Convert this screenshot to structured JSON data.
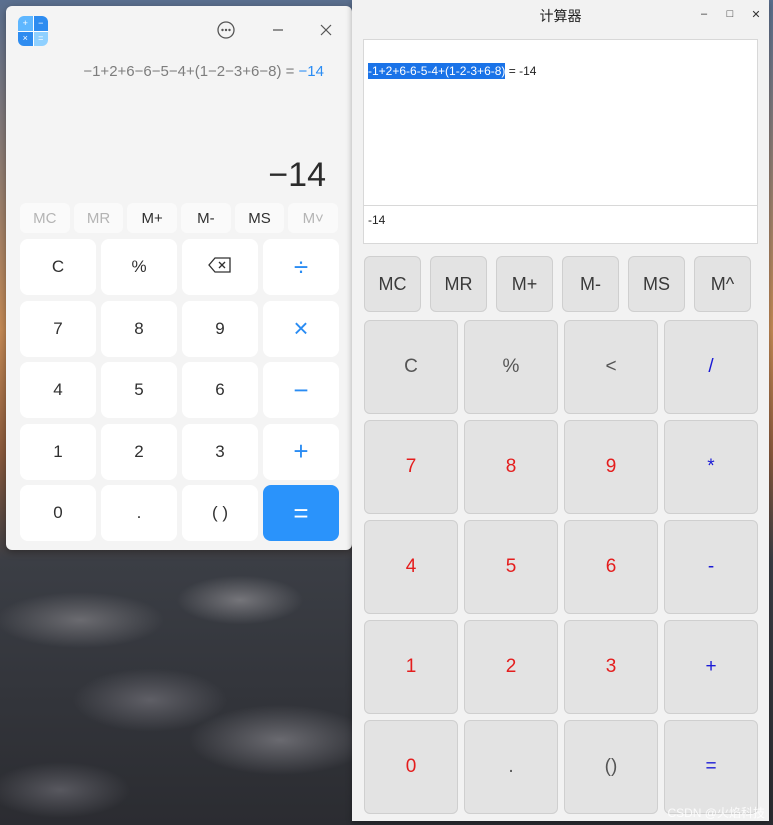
{
  "calc1": {
    "expression": "−1+2+6−6−5−4+(1−2−3+6−8) = ",
    "expression_result": "−14",
    "result": "−14",
    "memory_keys": [
      {
        "label": "MC",
        "disabled": true
      },
      {
        "label": "MR",
        "disabled": true
      },
      {
        "label": "M+",
        "disabled": false
      },
      {
        "label": "M-",
        "disabled": false
      },
      {
        "label": "MS",
        "disabled": false
      },
      {
        "label": "M˅",
        "disabled": true
      }
    ],
    "keys": [
      {
        "label": "C",
        "name": "clear-button",
        "type": "fn"
      },
      {
        "label": "%",
        "name": "percent-button",
        "type": "fn"
      },
      {
        "label": "⌫",
        "name": "backspace-button",
        "type": "fn"
      },
      {
        "label": "÷",
        "name": "divide-button",
        "type": "op"
      },
      {
        "label": "7",
        "name": "digit-7-button",
        "type": "num"
      },
      {
        "label": "8",
        "name": "digit-8-button",
        "type": "num"
      },
      {
        "label": "9",
        "name": "digit-9-button",
        "type": "num"
      },
      {
        "label": "×",
        "name": "multiply-button",
        "type": "op"
      },
      {
        "label": "4",
        "name": "digit-4-button",
        "type": "num"
      },
      {
        "label": "5",
        "name": "digit-5-button",
        "type": "num"
      },
      {
        "label": "6",
        "name": "digit-6-button",
        "type": "num"
      },
      {
        "label": "−",
        "name": "minus-button",
        "type": "op"
      },
      {
        "label": "1",
        "name": "digit-1-button",
        "type": "num"
      },
      {
        "label": "2",
        "name": "digit-2-button",
        "type": "num"
      },
      {
        "label": "3",
        "name": "digit-3-button",
        "type": "num"
      },
      {
        "label": "+",
        "name": "plus-button",
        "type": "op"
      },
      {
        "label": "0",
        "name": "digit-0-button",
        "type": "num"
      },
      {
        "label": ".",
        "name": "decimal-button",
        "type": "num"
      },
      {
        "label": "( )",
        "name": "parentheses-button",
        "type": "num"
      },
      {
        "label": "=",
        "name": "equals-button",
        "type": "eq"
      }
    ]
  },
  "calc2": {
    "title": "计算器",
    "history_selected": "-1+2+6-6-5-4+(1-2-3+6-8)",
    "history_rest": " = -14",
    "display": "-14",
    "memory_keys": [
      "MC",
      "MR",
      "M+",
      "M-",
      "MS",
      "M^"
    ],
    "keys": [
      {
        "label": "C",
        "name": "clear-button",
        "type": "fn"
      },
      {
        "label": "%",
        "name": "percent-button",
        "type": "fn"
      },
      {
        "label": "<",
        "name": "backspace-button",
        "type": "fn"
      },
      {
        "label": "/",
        "name": "divide-button",
        "type": "op"
      },
      {
        "label": "7",
        "name": "digit-7-button",
        "type": "num"
      },
      {
        "label": "8",
        "name": "digit-8-button",
        "type": "num"
      },
      {
        "label": "9",
        "name": "digit-9-button",
        "type": "num"
      },
      {
        "label": "*",
        "name": "multiply-button",
        "type": "op"
      },
      {
        "label": "4",
        "name": "digit-4-button",
        "type": "num"
      },
      {
        "label": "5",
        "name": "digit-5-button",
        "type": "num"
      },
      {
        "label": "6",
        "name": "digit-6-button",
        "type": "num"
      },
      {
        "label": "-",
        "name": "minus-button",
        "type": "op"
      },
      {
        "label": "1",
        "name": "digit-1-button",
        "type": "num"
      },
      {
        "label": "2",
        "name": "digit-2-button",
        "type": "num"
      },
      {
        "label": "3",
        "name": "digit-3-button",
        "type": "num"
      },
      {
        "label": "+",
        "name": "plus-button",
        "type": "op"
      },
      {
        "label": "0",
        "name": "digit-0-button",
        "type": "num"
      },
      {
        "label": ".",
        "name": "decimal-button",
        "type": "fn"
      },
      {
        "label": "()",
        "name": "parentheses-button",
        "type": "fn"
      },
      {
        "label": "=",
        "name": "equals-button",
        "type": "op"
      }
    ]
  },
  "watermark": "CSDN @火焰科技",
  "colors": {
    "accent_blue": "#2a8cf3",
    "equals_bg": "#2a93fb",
    "digit_red": "#e41d1d",
    "operator_blue": "#1a1ad6",
    "selection_blue": "#1a73e8"
  },
  "icons": {
    "menu": "more-options-icon",
    "minimize": "minimize-icon",
    "close": "close-icon",
    "app": "calculator-app-icon"
  }
}
